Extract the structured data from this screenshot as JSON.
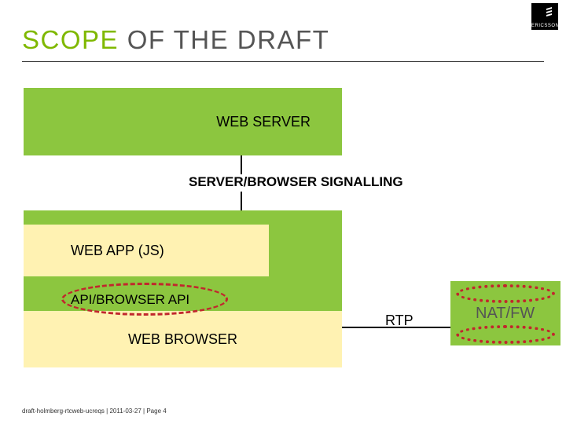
{
  "brand": {
    "name": "ERICSSON"
  },
  "title": {
    "accent": "SCOPE",
    "rest": " OF THE DRAFT"
  },
  "boxes": {
    "web_server": "WEB SERVER",
    "server_browser_signalling": "SERVER/BROWSER SIGNALLING",
    "web_app_js": "WEB APP (JS)",
    "api_browser_api": "API/BROWSER API",
    "web_browser": "WEB BROWSER"
  },
  "labels": {
    "rtp": "RTP",
    "natfw": "NAT/FW"
  },
  "footer": {
    "doc": "draft-holmberg-rtcweb-ucreqs",
    "sep": "  |  ",
    "date": "2011-03-27",
    "sep2": "  |  ",
    "page": "Page 4"
  },
  "colors": {
    "accent": "#8cc63f",
    "title_accent": "#7fb800",
    "yellow": "#fff2b2",
    "dash": "#c1272d"
  }
}
